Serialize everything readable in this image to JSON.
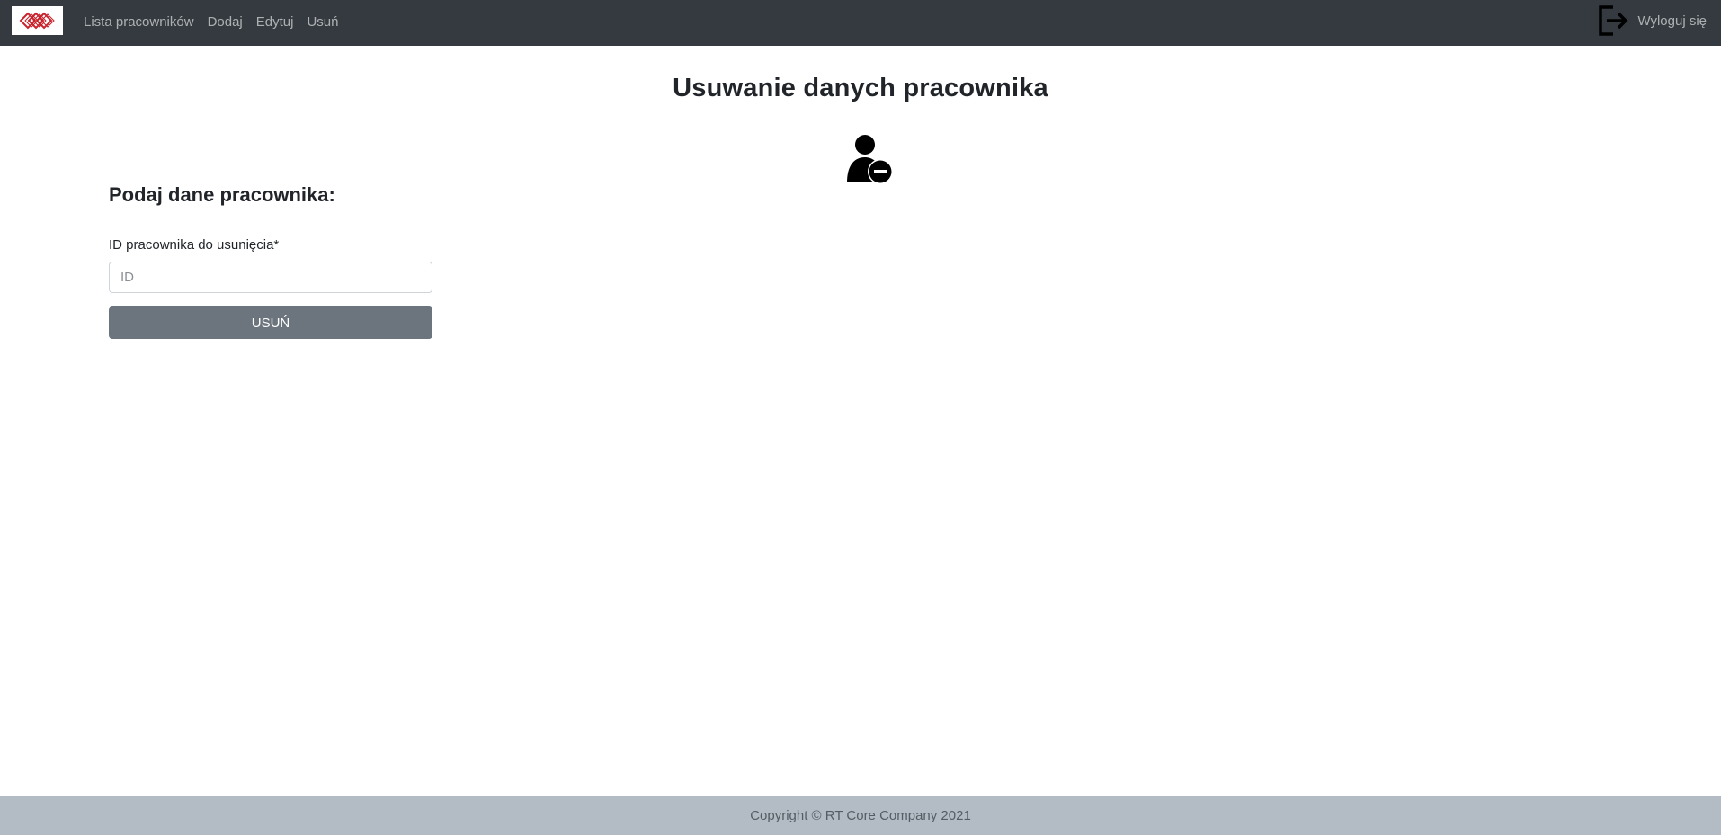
{
  "navbar": {
    "logo_icon": "company-diamond-logo",
    "links": [
      {
        "label": "Lista pracowników"
      },
      {
        "label": "Dodaj"
      },
      {
        "label": "Edytuj"
      },
      {
        "label": "Usuń"
      }
    ],
    "logout_icon": "box-arrow-right-icon",
    "logout_label": "Wyloguj się"
  },
  "main": {
    "title": "Usuwanie danych pracownika",
    "title_icon": "person-dash-icon",
    "form": {
      "heading": "Podaj dane pracownika:",
      "id_label": "ID pracownika do usunięcia*",
      "id_value": "",
      "id_placeholder": "ID",
      "submit_label": "USUŃ"
    }
  },
  "footer": {
    "copyright": "Copyright © RT Core Company 2021"
  },
  "colors": {
    "navbar_bg": "#343a40",
    "button_bg": "#6c757d",
    "footer_bg": "#b3bcc5",
    "logo_red": "#c8232c"
  }
}
